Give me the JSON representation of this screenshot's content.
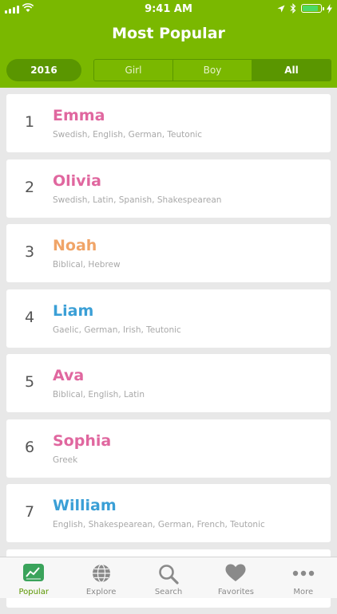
{
  "status_bar": {
    "time": "9:41 AM"
  },
  "header": {
    "title": "Most Popular"
  },
  "filters": {
    "year": "2016",
    "segments": [
      "Girl",
      "Boy",
      "All"
    ],
    "selected": "All"
  },
  "colors": {
    "header_bg": "#7ab800",
    "accent_dark": "#5a9600",
    "girl": "#e0679f",
    "boy": "#3a9fd6",
    "neutral": "#f0a467"
  },
  "names": [
    {
      "rank": "1",
      "name": "Emma",
      "origins": "Swedish, English, German, Teutonic",
      "gender": "girl"
    },
    {
      "rank": "2",
      "name": "Olivia",
      "origins": "Swedish, Latin, Spanish, Shakespearean",
      "gender": "girl"
    },
    {
      "rank": "3",
      "name": "Noah",
      "origins": "Biblical, Hebrew",
      "gender": "neutral"
    },
    {
      "rank": "4",
      "name": "Liam",
      "origins": "Gaelic, German, Irish, Teutonic",
      "gender": "boy"
    },
    {
      "rank": "5",
      "name": "Ava",
      "origins": "Biblical, English, Latin",
      "gender": "girl"
    },
    {
      "rank": "6",
      "name": "Sophia",
      "origins": "Greek",
      "gender": "girl"
    },
    {
      "rank": "7",
      "name": "William",
      "origins": "English, Shakespearean, German, French, Teutonic",
      "gender": "boy"
    }
  ],
  "tabbar": {
    "items": [
      {
        "label": "Popular",
        "icon": "trending-chart-icon"
      },
      {
        "label": "Explore",
        "icon": "globe-icon"
      },
      {
        "label": "Search",
        "icon": "search-icon"
      },
      {
        "label": "Favorites",
        "icon": "heart-icon"
      },
      {
        "label": "More",
        "icon": "more-icon"
      }
    ],
    "active": "Popular"
  }
}
